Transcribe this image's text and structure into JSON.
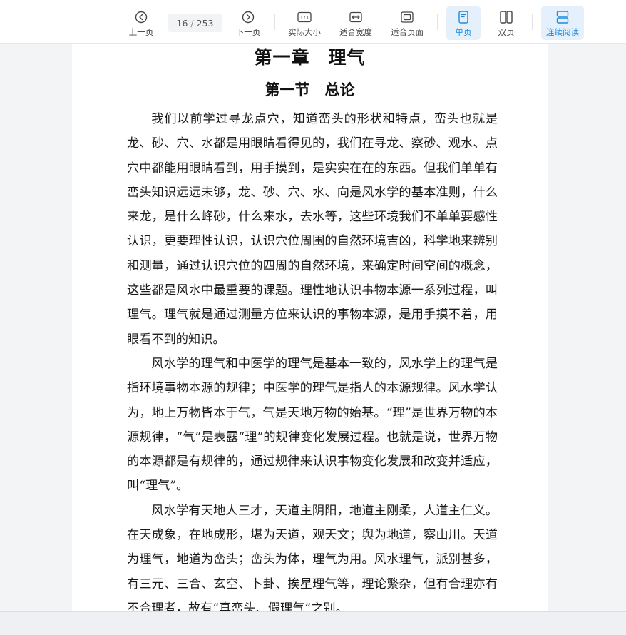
{
  "toolbar": {
    "prev_label": "上一页",
    "next_label": "下一页",
    "current_page": "16",
    "page_separator": "/",
    "total_pages": "253",
    "actual_size_label": "实际大小",
    "fit_width_label": "适合宽度",
    "fit_page_label": "适合页面",
    "single_page_label": "单页",
    "double_page_label": "双页",
    "continuous_label": "连续阅读",
    "accent_color": "#1a8be0",
    "active_bg": "#e4f0fb"
  },
  "document": {
    "chapter_title": "第一章　理气",
    "section_title": "第一节　总论",
    "paragraphs": [
      "我们以前学过寻龙点穴，知道峦头的形状和特点，峦头也就是龙、砂、穴、水都是用眼睛看得见的，我们在寻龙、察砂、观水、点穴中都能用眼睛看到，用手摸到，是实实在在的东西。但我们单单有峦头知识远远未够，龙、砂、穴、水、向是风水学的基本准则，什么来龙，是什么峰砂，什么来水，去水等，这些环境我们不单单要感性认识，更要理性认识，认识穴位周围的自然环境吉凶，科学地来辨别和测量，通过认识穴位的四周的自然环境，来确定时间空间的概念，这些都是风水中最重要的课题。理性地认识事物本源一系列过程，叫理气。理气就是通过测量方位来认识的事物本源，是用手摸不着，用眼看不到的知识。",
      "风水学的理气和中医学的理气是基本一致的，风水学上的理气是指环境事物本源的规律；中医学的理气是指人的本源规律。风水学认为，地上万物皆本于气，气是天地万物的始基。“理”是世界万物的本源规律，“气”是表露“理”的规律变化发展过程。也就是说，世界万物的本源都是有规律的，通过规律来认识事物变化发展和改变并适应，叫“理气”。",
      "风水学有天地人三才，天道主阴阳，地道主刚柔，人道主仁义。在天成象，在地成形，堪为天道，观天文；舆为地道，察山川。天道为理气，地道为峦头；峦头为体，理气为用。风水理气，派别甚多，有三元、三合、玄空、卜卦、挨星理气等，理论繁杂，但有合理亦有不合理者，故有“真峦头、假理气”之别。"
    ]
  }
}
